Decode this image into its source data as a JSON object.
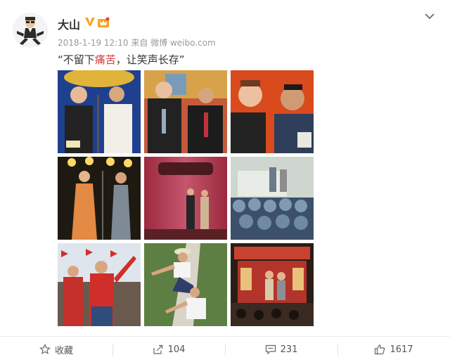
{
  "post": {
    "author": "大山",
    "timestamp": "2018-1-19 12:10",
    "source_prefix": "来自",
    "source": "微博 weibo.com",
    "text_open": "“不留下",
    "text_highlight": "痛苦",
    "text_close": "，让笑声长存”"
  },
  "photos": [
    {
      "desc": "two performers in traditional gowns at microphone"
    },
    {
      "desc": "two performers in suits with ties"
    },
    {
      "desc": "two performers laughing close-up"
    },
    {
      "desc": "two performers on stage under lights"
    },
    {
      "desc": "stage with red curtains and banner"
    },
    {
      "desc": "outdoor performance for crowd in helmets"
    },
    {
      "desc": "performers with red jackets outdoors"
    },
    {
      "desc": "person climbing a tree"
    },
    {
      "desc": "stage with red decorated background"
    }
  ],
  "actions": {
    "favorite_label": "收藏",
    "share_count": "104",
    "comment_count": "231",
    "like_count": "1617"
  },
  "colors": {
    "highlight": "#d33a3a",
    "vip_orange": "#f5a623"
  }
}
